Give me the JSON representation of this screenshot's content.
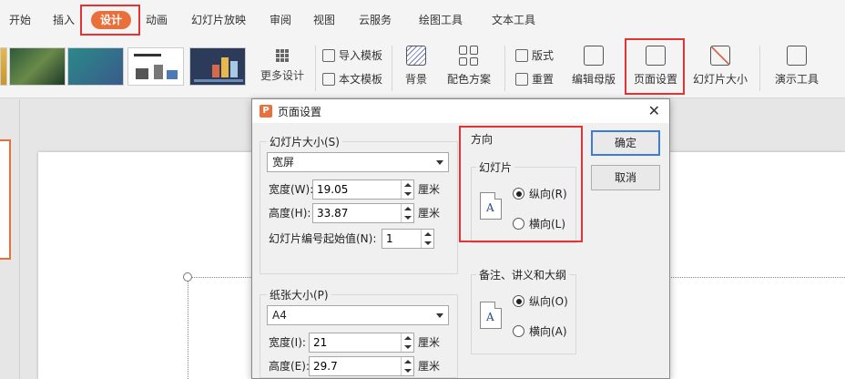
{
  "menu": {
    "items": [
      "开始",
      "插入",
      "设计",
      "动画",
      "幻灯片放映",
      "审阅",
      "视图",
      "云服务",
      "绘图工具",
      "文本工具"
    ],
    "active": "设计"
  },
  "ribbon": {
    "more_design": "更多设计",
    "import_template": "导入模板",
    "this_template": "本文模板",
    "background": "背景",
    "color_scheme": "配色方案",
    "layout": "版式",
    "reset": "重置",
    "edit_master": "编辑母版",
    "page_setup": "页面设置",
    "slide_size": "幻灯片大小",
    "presenter_tools": "演示工具"
  },
  "dialog": {
    "title": "页面设置",
    "close": "✕",
    "slide_size_group": "幻灯片大小(S)",
    "slide_size_value": "宽屏",
    "width_label": "宽度(W):",
    "width_value": "19.05",
    "height_label": "高度(H):",
    "height_value": "33.87",
    "unit": "厘米",
    "number_start_label": "幻灯片编号起始值(N):",
    "number_start_value": "1",
    "paper_group": "纸张大小(P)",
    "paper_value": "A4",
    "paper_width_label": "宽度(I):",
    "paper_width_value": "21",
    "paper_height_label": "高度(E):",
    "paper_height_value": "29.7",
    "orientation_title": "方向",
    "slides_group": "幻灯片",
    "portrait_r": "纵向(R)",
    "landscape_l": "横向(L)",
    "notes_group": "备注、讲义和大纲",
    "portrait_o": "纵向(O)",
    "landscape_a": "横向(A)",
    "ok": "确定",
    "cancel": "取消"
  },
  "colors": {
    "accent": "#e9703a",
    "highlight": "#e23434",
    "primary_border": "#3d7bd6"
  }
}
